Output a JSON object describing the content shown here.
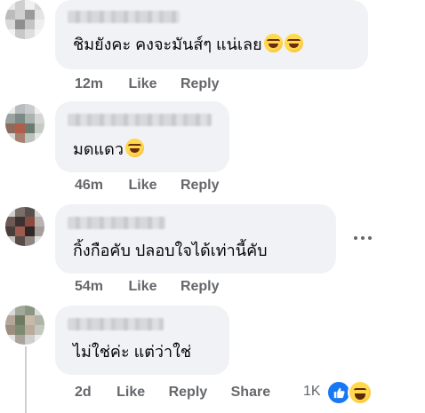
{
  "comments": [
    {
      "text": "ชิมยังคะ คงจะมันส์ๆ แน่เลย",
      "time": "12m",
      "like_label": "Like",
      "reply_label": "Reply"
    },
    {
      "text": "มดแดว",
      "time": "46m",
      "like_label": "Like",
      "reply_label": "Reply"
    },
    {
      "text": "กิ้งกือคับ ปลอบใจได้เท่านี้คับ",
      "time": "54m",
      "like_label": "Like",
      "reply_label": "Reply"
    },
    {
      "text": "ไม่ใช่ค่ะ แต่ว่าใช่",
      "time": "2d",
      "like_label": "Like",
      "reply_label": "Reply",
      "share_label": "Share",
      "reaction_count": "1K"
    }
  ],
  "colors": {
    "bubble": "#f0f2f5",
    "meta_text": "#65676b",
    "like_blue": "#1877f2"
  },
  "icons": {
    "emoji": "laughing-emoji-icon",
    "more": "more-options-icon",
    "like": "like-reaction-icon",
    "haha": "haha-reaction-icon"
  }
}
